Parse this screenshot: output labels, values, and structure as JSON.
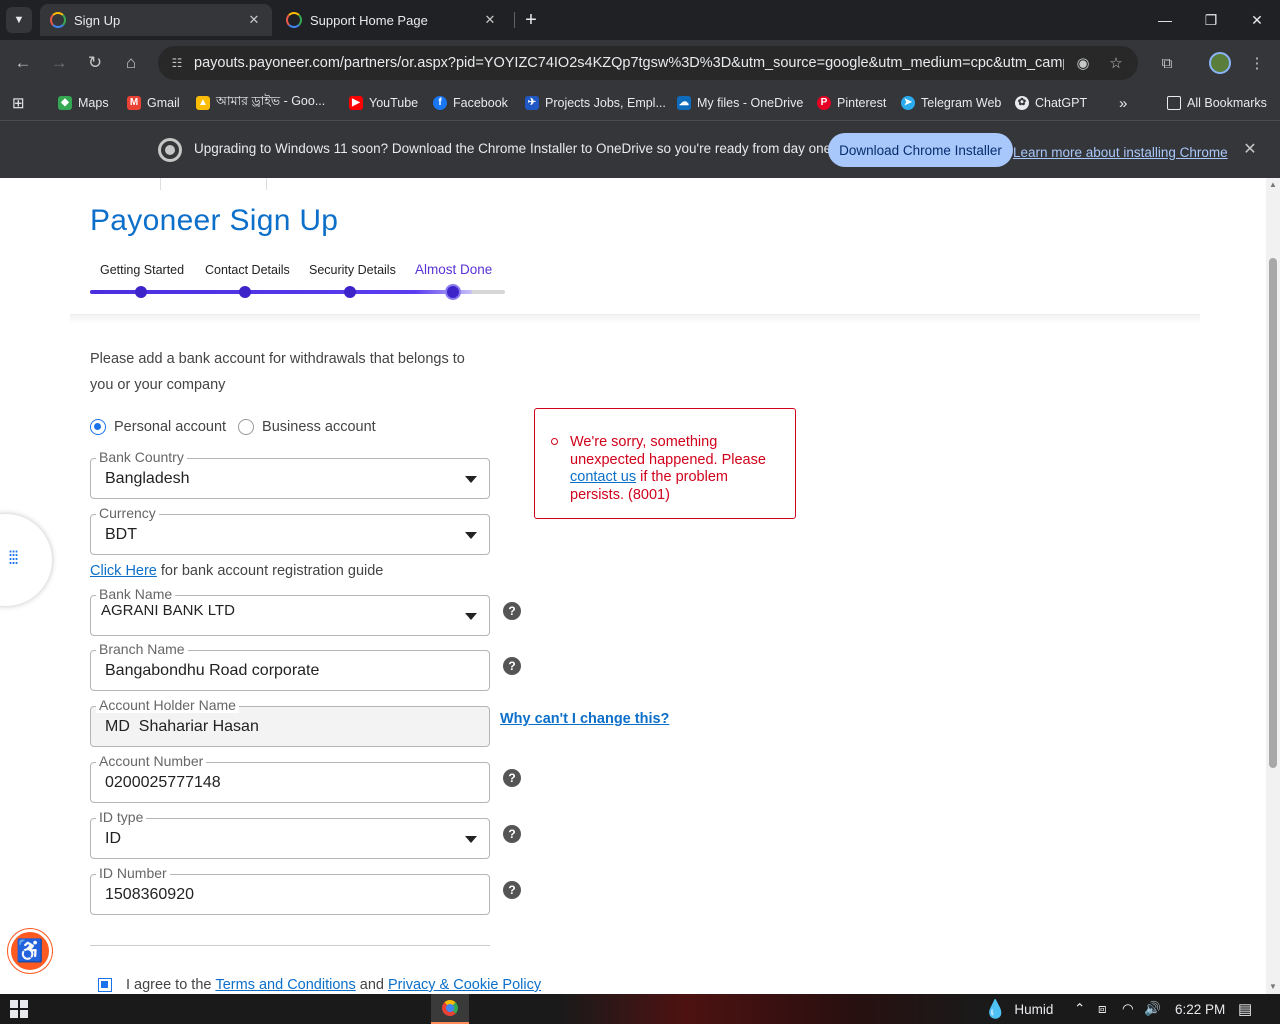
{
  "browser": {
    "tabs": [
      {
        "label": "Sign Up",
        "active": true
      },
      {
        "label": "Support Home Page",
        "active": false
      }
    ],
    "url_host": "payouts.payoneer.com",
    "url_rest": "/partners/or.aspx?pid=YOYIZC74IO2s4KZQp7tgsw%3D%3D&utm_source=google&utm_medium=cpc&utm_campai...",
    "bookmarks": [
      {
        "label": "Maps",
        "color": "#34a853",
        "icon": "maps-icon"
      },
      {
        "label": "Gmail",
        "color": "#ea4335",
        "icon": "gmail-icon"
      },
      {
        "label": "আমার ড্রাইভ - Goo...",
        "color": "#fbbc04",
        "icon": "drive-icon"
      },
      {
        "label": "YouTube",
        "color": "#ff0000",
        "icon": "youtube-icon"
      },
      {
        "label": "Facebook",
        "color": "#1877f2",
        "icon": "facebook-icon"
      },
      {
        "label": "Projects Jobs, Empl...",
        "color": "#1f57c3",
        "icon": "freelancer-icon"
      },
      {
        "label": "My files - OneDrive",
        "color": "#0f6cbd",
        "icon": "onedrive-icon"
      },
      {
        "label": "Pinterest",
        "color": "#e60023",
        "icon": "pinterest-icon"
      },
      {
        "label": "Telegram Web",
        "color": "#2aabee",
        "icon": "telegram-icon"
      },
      {
        "label": "ChatGPT",
        "color": "#e8eaed",
        "icon": "chatgpt-icon"
      }
    ],
    "all_bookmarks": "All Bookmarks",
    "infobar": {
      "message": "Upgrading to Windows 11 soon? Download the Chrome Installer to OneDrive so you're ready from day one.",
      "button": "Download Chrome Installer",
      "link": "Learn more about installing Chrome"
    }
  },
  "page": {
    "title": "Payoneer Sign Up",
    "steps": [
      "Getting Started",
      "Contact Details",
      "Security Details",
      "Almost Done"
    ],
    "current_step": 4,
    "progress_fraction": 0.92,
    "intro": "Please add a bank account for withdrawals that belongs to you or your company",
    "account_types": {
      "personal": "Personal account",
      "business": "Business account",
      "selected": "personal"
    },
    "fields": {
      "bank_country": {
        "label": "Bank Country",
        "value": "Bangladesh"
      },
      "currency": {
        "label": "Currency",
        "value": "BDT"
      },
      "bank_name": {
        "label": "Bank Name",
        "value": "AGRANI BANK LTD"
      },
      "branch_name": {
        "label": "Branch Name",
        "value": "Bangabondhu Road corporate"
      },
      "holder_name": {
        "label": "Account Holder Name",
        "value": "MD  Shahariar Hasan"
      },
      "account_number": {
        "label": "Account Number",
        "value": "0200025777148"
      },
      "id_type": {
        "label": "ID type",
        "value": "ID"
      },
      "id_number": {
        "label": "ID Number",
        "value": "1508360920"
      }
    },
    "guide": {
      "link": "Click Here",
      "text": " for bank account registration guide"
    },
    "why_link": "Why can't I change this?",
    "help_glyph": "?",
    "error": {
      "before": "We're sorry, something unexpected happened. Please ",
      "link": "contact us",
      "after": " if the problem persists. (8001)",
      "color": "#d0021b"
    },
    "agree": {
      "prefix": "I agree to the ",
      "terms": "Terms and Conditions",
      "middle": " and ",
      "privacy": "Privacy & Cookie Policy",
      "checked": true
    }
  },
  "taskbar": {
    "weather": "Humid",
    "time": "6:22 PM"
  },
  "colors": {
    "brand": "#0c6fc9",
    "progress": "#3d24c9",
    "error": "#d0021b",
    "accessibility": "#ff5a1f"
  }
}
